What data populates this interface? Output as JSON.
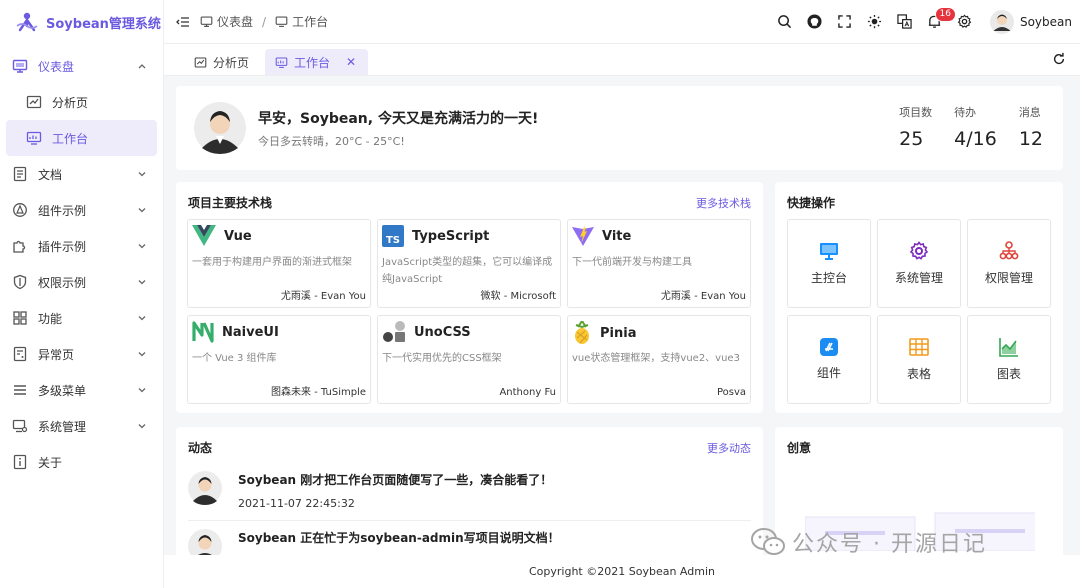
{
  "app": {
    "title": "Soybean管理系统"
  },
  "sidebar": {
    "items": [
      {
        "label": "仪表盘",
        "icon": "monitor-icon"
      },
      {
        "label": "分析页",
        "icon": "chart-icon"
      },
      {
        "label": "工作台",
        "icon": "desktop-icon"
      },
      {
        "label": "文档",
        "icon": "document-icon"
      },
      {
        "label": "组件示例",
        "icon": "compass-icon"
      },
      {
        "label": "插件示例",
        "icon": "puzzle-icon"
      },
      {
        "label": "权限示例",
        "icon": "shield-icon"
      },
      {
        "label": "功能",
        "icon": "grid-icon"
      },
      {
        "label": "异常页",
        "icon": "warning-page-icon"
      },
      {
        "label": "多级菜单",
        "icon": "menu-icon"
      },
      {
        "label": "系统管理",
        "icon": "settings-monitor-icon"
      },
      {
        "label": "关于",
        "icon": "info-icon"
      }
    ]
  },
  "header": {
    "breadcrumb": [
      "仪表盘",
      "工作台"
    ],
    "notification_count": "16",
    "username": "Soybean"
  },
  "tabs": [
    {
      "label": "分析页"
    },
    {
      "label": "工作台"
    }
  ],
  "welcome": {
    "greeting": "早安，Soybean, 今天又是充满活力的一天!",
    "weather": "今日多云转晴，20°C - 25°C!",
    "stats": [
      {
        "label": "项目数",
        "value": "25"
      },
      {
        "label": "待办",
        "value": "4/16"
      },
      {
        "label": "消息",
        "value": "12"
      }
    ]
  },
  "tech": {
    "title": "项目主要技术栈",
    "more": "更多技术栈",
    "projects": [
      {
        "name": "Vue",
        "desc": "一套用于构建用户界面的渐进式框架",
        "author": "尤雨溪 - Evan You"
      },
      {
        "name": "TypeScript",
        "desc": "JavaScript类型的超集，它可以编译成纯JavaScript",
        "author": "微软 - Microsoft"
      },
      {
        "name": "Vite",
        "desc": "下一代前端开发与构建工具",
        "author": "尤雨溪 - Evan You"
      },
      {
        "name": "NaiveUI",
        "desc": "一个 Vue 3 组件库",
        "author": "图森未来 - TuSimple"
      },
      {
        "name": "UnoCSS",
        "desc": "下一代实用优先的CSS框架",
        "author": "Anthony Fu"
      },
      {
        "name": "Pinia",
        "desc": "vue状态管理框架，支持vue2、vue3",
        "author": "Posva"
      }
    ]
  },
  "quick": {
    "title": "快捷操作",
    "actions": [
      {
        "label": "主控台"
      },
      {
        "label": "系统管理"
      },
      {
        "label": "权限管理"
      },
      {
        "label": "组件"
      },
      {
        "label": "表格"
      },
      {
        "label": "图表"
      }
    ]
  },
  "activity": {
    "title": "动态",
    "more": "更多动态",
    "items": [
      {
        "text": "Soybean 刚才把工作台页面随便写了一些，凑合能看了！",
        "time": "2021-11-07 22:45:32"
      },
      {
        "text": "Soybean 正在忙于为soybean-admin写项目说明文档！"
      }
    ]
  },
  "idea": {
    "title": "创意"
  },
  "watermark": {
    "text": "公众号 · 开源日记"
  },
  "footer": {
    "text": "Copyright ©2021 Soybean Admin"
  },
  "colors": {
    "primary": "#6a5ae0",
    "badge": "#e5343d"
  }
}
